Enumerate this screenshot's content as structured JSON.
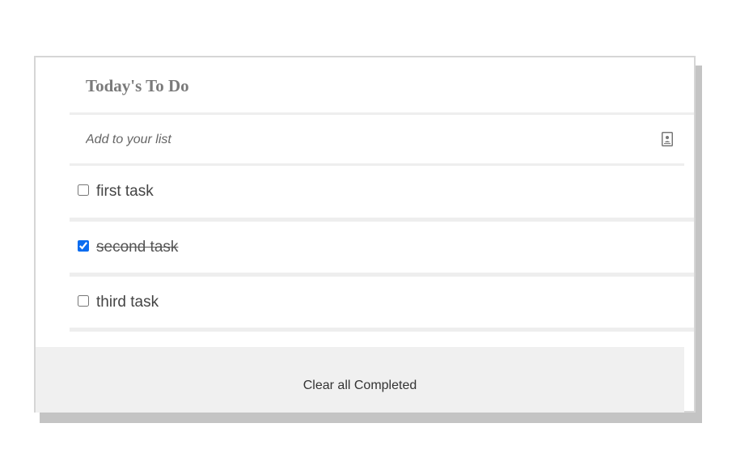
{
  "app": {
    "title": "Today's To Do"
  },
  "add_input": {
    "placeholder": "Add to your list",
    "value": "",
    "icon": "contact-card-icon"
  },
  "tasks": [
    {
      "label": "first task",
      "completed": false
    },
    {
      "label": "second task",
      "completed": true
    },
    {
      "label": "third task",
      "completed": false
    }
  ],
  "footer": {
    "clear_label": "Clear all Completed"
  },
  "colors": {
    "title": "#7a7a7a",
    "separator": "#eeeeee",
    "footer_bg": "#f0f0f0",
    "shadow": "#c4c4c4",
    "checkbox_accent": "#0a6cf0"
  }
}
